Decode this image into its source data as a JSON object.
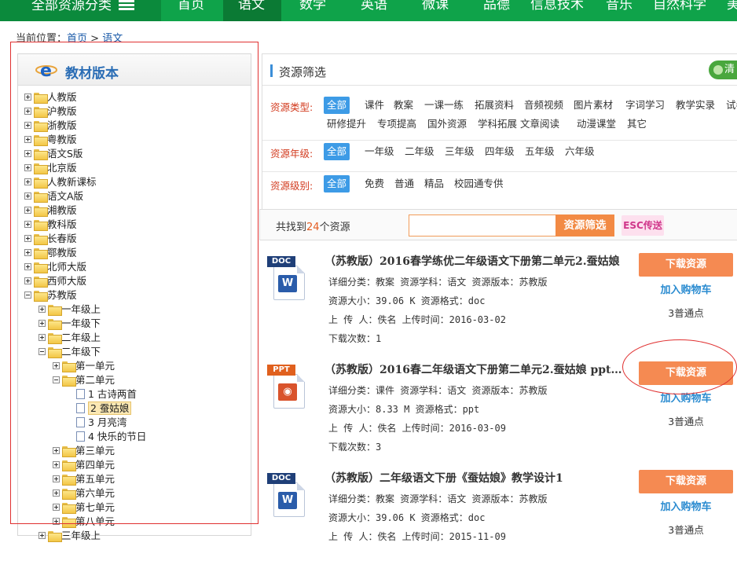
{
  "nav": {
    "all_categories": "全部资源分类",
    "items": [
      "首页",
      "语文",
      "数学",
      "英语",
      "微课",
      "品德",
      "信息技术",
      "音乐",
      "自然科学",
      "美"
    ]
  },
  "breadcrumb": {
    "prefix": "当前位置：",
    "home": "首页",
    "sep": ">",
    "current": "语文"
  },
  "left_panel": {
    "title": "教材版本",
    "editions": [
      "人教版",
      "沪教版",
      "浙教版",
      "粤教版",
      "语文S版",
      "北京版",
      "人教新课标",
      "语文A版",
      "湘教版",
      "教科版",
      "长春版",
      "鄂教版",
      "北师大版",
      "西师大版",
      "苏教版"
    ],
    "grades": [
      "一年级上",
      "一年级下",
      "二年级上",
      "二年级下"
    ],
    "units_before": [
      "第一单元",
      "第二单元"
    ],
    "lessons": [
      "1 古诗两首",
      "2 蚕姑娘",
      "3 月亮湾",
      "4 快乐的节日"
    ],
    "units_after": [
      "第三单元",
      "第四单元",
      "第五单元",
      "第六单元",
      "第七单元",
      "第八单元"
    ],
    "next_grade": "三年级上"
  },
  "filter": {
    "title": "资源筛选",
    "clear_label": "清",
    "type": {
      "label": "资源类型:",
      "row1": [
        "全部",
        "课件",
        "教案",
        "一课一练",
        "拓展资料",
        "音频视频",
        "图片素材",
        "字词学习",
        "教学实录",
        "试卷"
      ],
      "row2": [
        "研修提升",
        "专项提高",
        "国外资源",
        "学科拓展",
        "文章阅读",
        "动漫课堂",
        "其它"
      ]
    },
    "grade": {
      "label": "资源年级:",
      "options": [
        "全部",
        "一年级",
        "二年级",
        "三年级",
        "四年级",
        "五年级",
        "六年级"
      ]
    },
    "level": {
      "label": "资源级别:",
      "options": [
        "全部",
        "免费",
        "普通",
        "精品",
        "校园通专供"
      ]
    }
  },
  "search": {
    "found_prefix": "共找到",
    "count": "24",
    "found_suffix": "个资源",
    "input_value": "",
    "button": "资源筛选",
    "esc_button": "ESC传送"
  },
  "results": [
    {
      "icon": "doc-file-icon",
      "tag": "DOC",
      "tag_color": "#1f3f78",
      "title": "（苏教版）2016春学练优二年级语文下册第二单元2.蚕姑娘",
      "line1": "详细分类：教案  资源学科：语文  资源版本：苏教版",
      "line2": "资源大小：39.06 K  资源格式：doc",
      "line3": "上 传 人：佚名  上传时间：2016-03-02",
      "line4": "下载次数：1",
      "download": "下载资源",
      "cart": "加入购物车",
      "points": "3普通点"
    },
    {
      "icon": "ppt-file-icon",
      "tag": "PPT",
      "tag_color": "#e0601e",
      "title": "（苏教版）2016春二年级语文下册第二单元2.蚕姑娘 ppt…",
      "line1": "详细分类：课件  资源学科：语文  资源版本：苏教版",
      "line2": "资源大小：8.33 M  资源格式：ppt",
      "line3": "上 传 人：佚名  上传时间：2016-03-09",
      "line4": "下载次数：3",
      "download": "下载资源",
      "cart": "加入购物车",
      "points": "3普通点"
    },
    {
      "icon": "doc-file-icon",
      "tag": "DOC",
      "tag_color": "#1f3f78",
      "title": "（苏教版）二年级语文下册《蚕姑娘》教学设计1",
      "line1": "详细分类：教案  资源学科：语文  资源版本：苏教版",
      "line2": "资源大小：39.06 K  资源格式：doc",
      "line3": "上 传 人：佚名  上传时间：2015-11-09",
      "line4": "",
      "download": "下载资源",
      "cart": "加入购物车",
      "points": "3普通点"
    }
  ]
}
